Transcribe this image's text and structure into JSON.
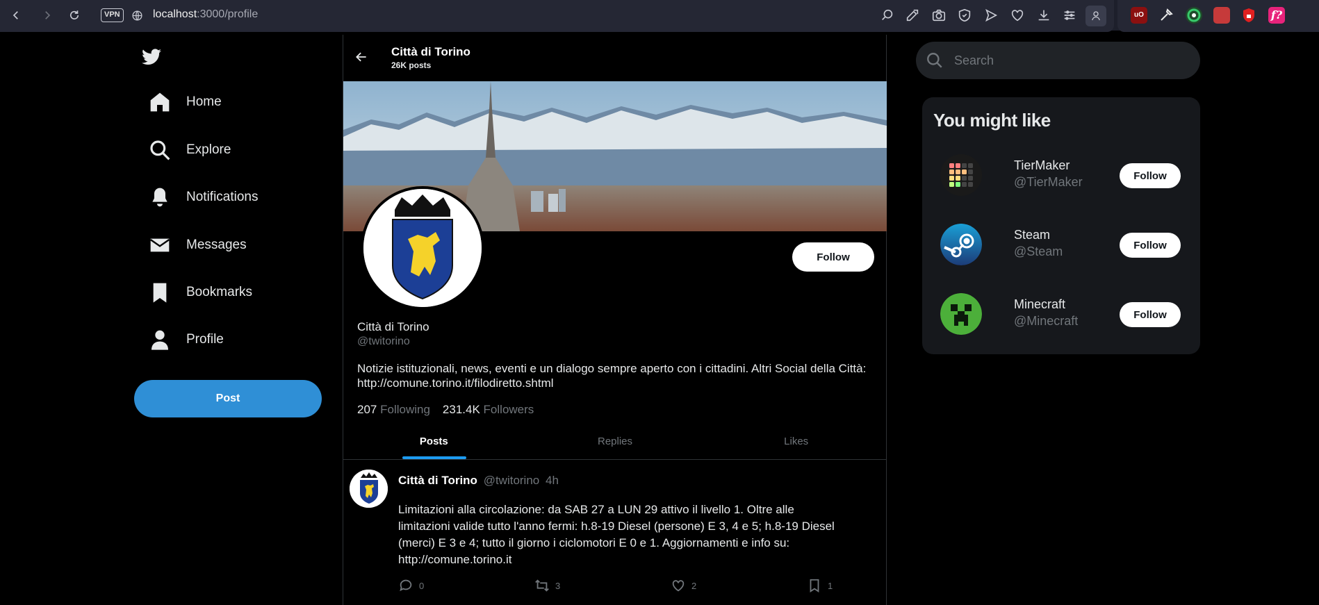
{
  "browser": {
    "url_host": "localhost",
    "url_path": ":3000/profile",
    "vpn_label": "VPN"
  },
  "nav": {
    "items": [
      {
        "label": "Home",
        "icon": "home-icon"
      },
      {
        "label": "Explore",
        "icon": "search-icon"
      },
      {
        "label": "Notifications",
        "icon": "bell-icon"
      },
      {
        "label": "Messages",
        "icon": "envelope-icon"
      },
      {
        "label": "Bookmarks",
        "icon": "bookmark-icon"
      },
      {
        "label": "Profile",
        "icon": "person-icon"
      }
    ],
    "post_label": "Post"
  },
  "profile": {
    "header_name": "Città di Torino",
    "header_count": "26K posts",
    "name": "Città di Torino",
    "handle": "@twitorino",
    "follow_label": "Follow",
    "bio": "Notizie istituzionali, news, eventi e un dialogo sempre aperto con i cittadini. Altri Social della Città: http://comune.torino.it/filodiretto.shtml",
    "following_count": "207",
    "following_label": "Following",
    "followers_count": "231.4K",
    "followers_label": "Followers"
  },
  "tabs": [
    {
      "label": "Posts",
      "active": true
    },
    {
      "label": "Replies",
      "active": false
    },
    {
      "label": "Likes",
      "active": false
    }
  ],
  "tweet": {
    "name": "Città di Torino",
    "handle": "@twitorino",
    "time": "4h",
    "text": "Limitazioni alla circolazione: da SAB 27 a LUN 29 attivo il livello 1. Oltre alle limitazioni valide tutto l'anno fermi: h.8-19 Diesel (persone) E 3, 4 e 5; h.8-19 Diesel (merci) E 3 e 4; tutto il giorno i ciclomotori E 0 e 1. Aggiornamenti e info su: http://comune.torino.it",
    "replies": "0",
    "retweets": "3",
    "likes": "2",
    "bookmarks": "1"
  },
  "search": {
    "placeholder": "Search"
  },
  "who_to_follow": {
    "title": "You might like",
    "items": [
      {
        "name": "TierMaker",
        "handle": "@TierMaker",
        "follow_label": "Follow"
      },
      {
        "name": "Steam",
        "handle": "@Steam",
        "follow_label": "Follow"
      },
      {
        "name": "Minecraft",
        "handle": "@Minecraft",
        "follow_label": "Follow"
      }
    ]
  },
  "colors": {
    "accent": "#1d9bf0",
    "post_button": "#2f8fd6",
    "background": "#000000",
    "muted_text": "#71767b"
  }
}
